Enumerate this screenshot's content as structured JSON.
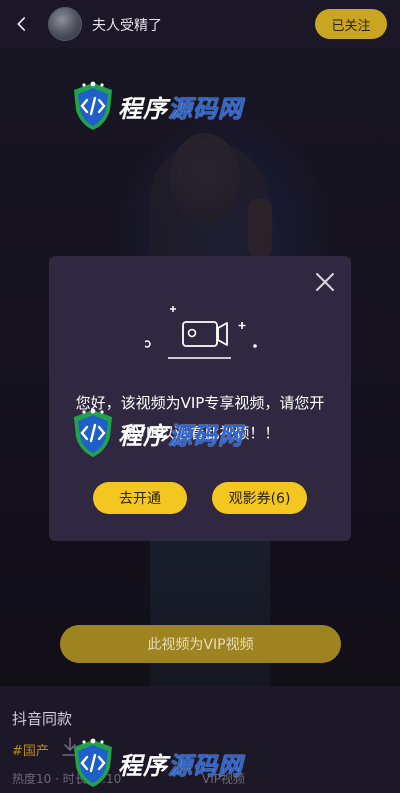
{
  "header": {
    "username": "夫人受精了",
    "follow_label": "已关注",
    "back_icon": "back-arrow-icon"
  },
  "watermark": {
    "part1": "程序",
    "part2": "源码网"
  },
  "modal": {
    "message": "您好，该视频为VIP专享视频，请您开通VIP以观看此视频！！",
    "open_button": "去开通",
    "coupon_button": "观影券(6)",
    "close_icon": "close-icon",
    "illustration_icon": "video-camera-icon"
  },
  "vip_bar_label": "此视频为VIP视频",
  "info": {
    "title": "抖音同款",
    "tag": "#国产",
    "meta_left": "热度10 · 时长00:10",
    "meta_right": "VIP视频"
  },
  "colors": {
    "accent": "#f3c620",
    "follow": "#c9a621",
    "vip_bar": "#9e8421",
    "modal_bg": "#2f2840",
    "tag": "#b88a25"
  }
}
